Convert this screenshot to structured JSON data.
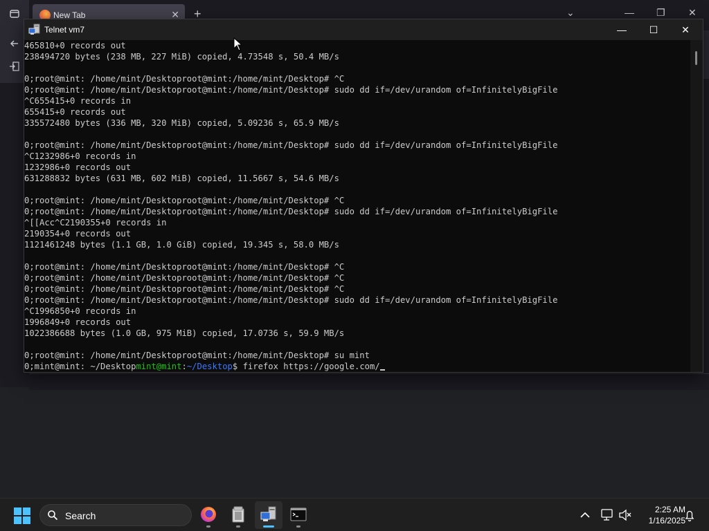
{
  "browser": {
    "tab_title": "New Tab",
    "tab_close": "✕",
    "new_tab": "+",
    "list_all_tabs": "⌄",
    "minimize": "—",
    "restore": "❐",
    "close": "✕"
  },
  "telnet": {
    "title": "Telnet vm7",
    "minimize": "—",
    "maximize": "☐",
    "close": "✕",
    "lines": [
      {
        "text": "465810+0 records out"
      },
      {
        "text": "238494720 bytes (238 MB, 227 MiB) copied, 4.73548 s, 50.4 MB/s"
      },
      {
        "text": ""
      },
      {
        "text": "0;root@mint: /home/mint/Desktoproot@mint:/home/mint/Desktop# ^C"
      },
      {
        "text": "0;root@mint: /home/mint/Desktoproot@mint:/home/mint/Desktop# sudo dd if=/dev/urandom of=InfinitelyBigFile"
      },
      {
        "text": "^C655415+0 records in"
      },
      {
        "text": "655415+0 records out"
      },
      {
        "text": "335572480 bytes (336 MB, 320 MiB) copied, 5.09236 s, 65.9 MB/s"
      },
      {
        "text": ""
      },
      {
        "text": "0;root@mint: /home/mint/Desktoproot@mint:/home/mint/Desktop# sudo dd if=/dev/urandom of=InfinitelyBigFile"
      },
      {
        "text": "^C1232986+0 records in"
      },
      {
        "text": "1232986+0 records out"
      },
      {
        "text": "631288832 bytes (631 MB, 602 MiB) copied, 11.5667 s, 54.6 MB/s"
      },
      {
        "text": ""
      },
      {
        "text": "0;root@mint: /home/mint/Desktoproot@mint:/home/mint/Desktop# ^C"
      },
      {
        "text": "0;root@mint: /home/mint/Desktoproot@mint:/home/mint/Desktop# sudo dd if=/dev/urandom of=InfinitelyBigFile"
      },
      {
        "text": "^[[Acc^C2190355+0 records in"
      },
      {
        "text": "2190354+0 records out"
      },
      {
        "text": "1121461248 bytes (1.1 GB, 1.0 GiB) copied, 19.345 s, 58.0 MB/s"
      },
      {
        "text": ""
      },
      {
        "text": "0;root@mint: /home/mint/Desktoproot@mint:/home/mint/Desktop# ^C"
      },
      {
        "text": "0;root@mint: /home/mint/Desktoproot@mint:/home/mint/Desktop# ^C"
      },
      {
        "text": "0;root@mint: /home/mint/Desktoproot@mint:/home/mint/Desktop# ^C"
      },
      {
        "text": "0;root@mint: /home/mint/Desktoproot@mint:/home/mint/Desktop# sudo dd if=/dev/urandom of=InfinitelyBigFile"
      },
      {
        "text": "^C1996850+0 records in"
      },
      {
        "text": "1996849+0 records out"
      },
      {
        "text": "1022386688 bytes (1.0 GB, 975 MiB) copied, 17.0736 s, 59.9 MB/s"
      },
      {
        "text": ""
      },
      {
        "text": "0;root@mint: /home/mint/Desktoproot@mint:/home/mint/Desktop# su mint"
      }
    ],
    "prompt_line": {
      "prefix": "0;mint@mint: ~/Desktop",
      "user_host": "mint@mint",
      "colon": ":",
      "path": "~/Desktop",
      "dollar": "$ ",
      "command": "firefox https://google.com/"
    }
  },
  "taskbar": {
    "search_label": "Search",
    "apps": [
      "firefox-icon",
      "file-explorer-icon",
      "telnet-icon",
      "terminal-icon"
    ],
    "clock_time": "2:25 AM",
    "clock_date": "1/16/2025",
    "accent_color": "#4cc2ff"
  }
}
